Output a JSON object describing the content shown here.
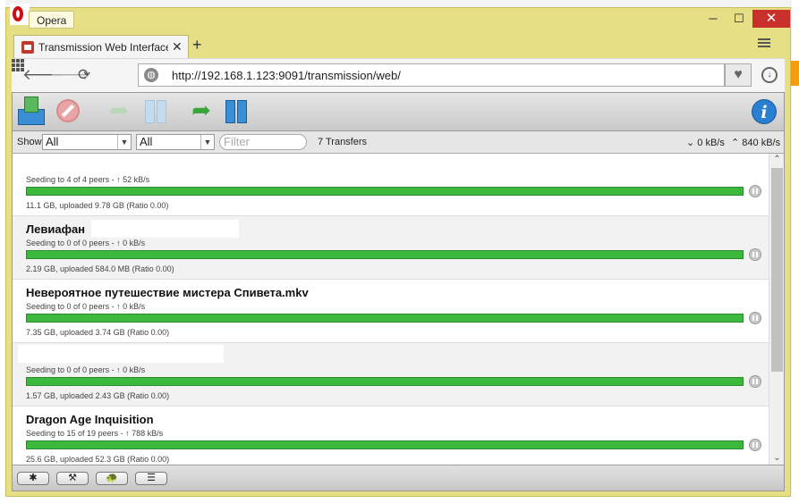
{
  "browser": {
    "menu_label": "Opera",
    "window_controls": {
      "minimize": "─",
      "maximize": "☐",
      "close": "✕"
    },
    "tab": {
      "title": "Transmission Web Interface",
      "close": "✕"
    },
    "new_tab": "+",
    "address_bar": {
      "url": "http://192.168.1.123:9091/transmission/web/"
    },
    "nav_icons": [
      "back-arrow-icon",
      "forward-arrow-icon",
      "reload-icon",
      "speed-dial-icon"
    ],
    "bookmark_icon": "heart-icon",
    "download_icon": "download-icon"
  },
  "toolbar": {
    "icons": [
      "open-torrent-icon",
      "remove-torrent-icon",
      "resume-icon",
      "pause-icon",
      "resume-all-icon",
      "pause-all-icon",
      "info-icon"
    ],
    "info_label": "i"
  },
  "filterbar": {
    "show_label": "Show",
    "status_filter": "All",
    "tracker_filter": "All",
    "filter_placeholder": "Filter",
    "transfer_count": "7 Transfers",
    "download_rate": "0 kB/s",
    "upload_rate": "840 kB/s"
  },
  "torrents": [
    {
      "name": "",
      "status": "Seeding to 4 of 4 peers - ↑ 52 kB/s",
      "progress": 1.0,
      "size": "11.1 GB, uploaded 9.78 GB (Ratio 0.00)"
    },
    {
      "name": "Левиафан",
      "status": "Seeding to 0 of 0 peers - ↑ 0 kB/s",
      "progress": 1.0,
      "size": "2.19 GB, uploaded 584.0 MB (Ratio 0.00)"
    },
    {
      "name": "Невероятное путешествие мистера Спивета.mkv",
      "status": "Seeding to 0 of 0 peers - ↑ 0 kB/s",
      "progress": 1.0,
      "size": "7.35 GB, uploaded 3.74 GB (Ratio 0.00)"
    },
    {
      "name": "",
      "status": "Seeding to 0 of 0 peers - ↑ 0 kB/s",
      "progress": 1.0,
      "size": "1.57 GB, uploaded 2.43 GB (Ratio 0.00)"
    },
    {
      "name": "Dragon Age Inquisition",
      "status": "Seeding to 15 of 19 peers - ↑ 788 kB/s",
      "progress": 1.0,
      "size": "25.6 GB, uploaded 52.3 GB (Ratio 0.00)"
    }
  ],
  "footer": {
    "buttons": [
      {
        "label": "✱",
        "icon": "settings-gear-icon"
      },
      {
        "label": "⚒",
        "icon": "wrench-icon"
      },
      {
        "label": "🐢",
        "icon": "turtle-icon"
      },
      {
        "label": "☰",
        "icon": "sort-list-icon"
      }
    ]
  },
  "colors": {
    "window_frame": "#e7df86",
    "progress_green": "#3cb93c",
    "close_red": "#c9302c",
    "info_blue": "#2a7fd0"
  }
}
